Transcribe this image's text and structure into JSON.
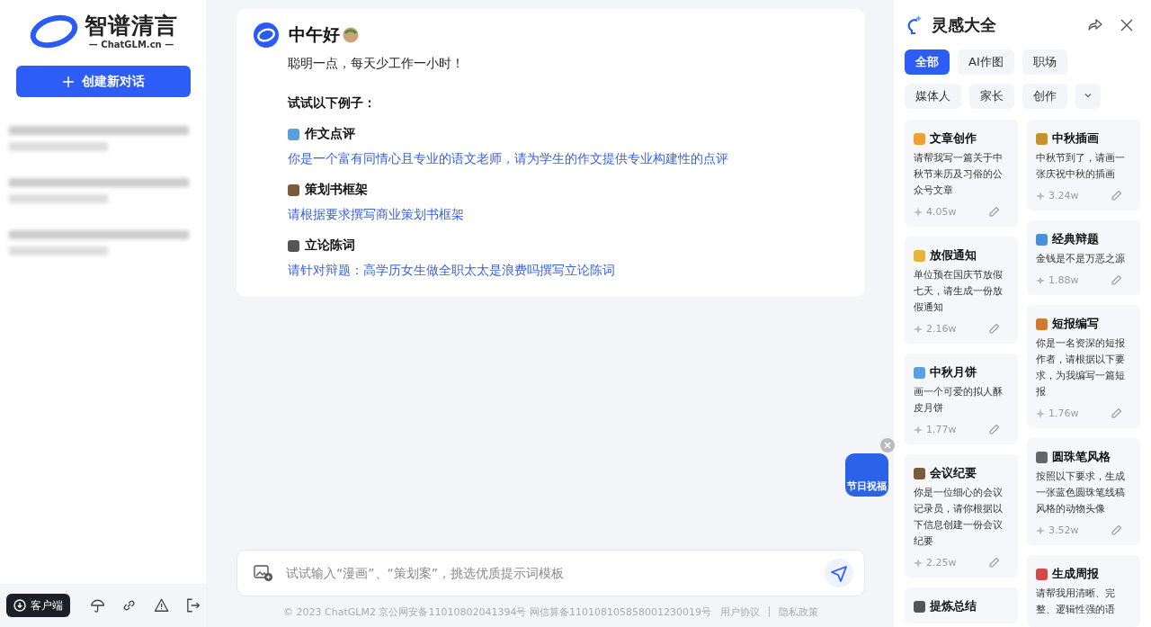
{
  "sidebar": {
    "logo": {
      "name": "智谱清言",
      "domain": "— ChatGLM.cn —"
    },
    "new_chat_button": "创建新对话",
    "bottom": {
      "client_button": "客户端"
    }
  },
  "chat": {
    "greeting": "中午好",
    "subtitle": "聪明一点，每天少工作一小时！",
    "examples_heading": "试试以下例子：",
    "examples": [
      {
        "title": "作文点评",
        "prompt": "你是一个富有同情心且专业的语文老师，请为学生的作文提供专业构建性的点评"
      },
      {
        "title": "策划书框架",
        "prompt": "请根据要求撰写商业策划书框架"
      },
      {
        "title": "立论陈词",
        "prompt": "请针对辩题：高学历女生做全职太太是浪费吗撰写立论陈词"
      }
    ],
    "input": {
      "placeholder": "试试输入“漫画”、“策划案”，挑选优质提示词模板"
    },
    "festival_badge": "节日祝福"
  },
  "footer": {
    "notice": "© 2023 ChatGLM2 京公网安备11010802041394号 网信算备110108105858001230019号",
    "links": [
      "用户协议",
      "隐私政策"
    ]
  },
  "inspiration": {
    "title": "灵感大全",
    "tabs": [
      {
        "label": "全部",
        "selected": true
      },
      {
        "label": "AI作图",
        "selected": false
      },
      {
        "label": "职场",
        "selected": false
      },
      {
        "label": "媒体人",
        "selected": false
      },
      {
        "label": "家长",
        "selected": false
      },
      {
        "label": "创作",
        "selected": false
      }
    ],
    "columns": [
      [
        {
          "title": "文章创作",
          "desc": "请帮我写一篇关于中秋节来历及习俗的公众号文章",
          "count": "4.05w"
        },
        {
          "title": "放假通知",
          "desc": "单位预在国庆节放假七天，请生成一份放假通知",
          "count": "2.16w"
        },
        {
          "title": "中秋月饼",
          "desc": "画一个可爱的拟人酥皮月饼",
          "count": "1.77w"
        },
        {
          "title": "会议纪要",
          "desc": "你是一位细心的会议记录员，请你根据以下信息创建一份会议纪要",
          "count": "2.25w"
        },
        {
          "title": "提炼总结"
        }
      ],
      [
        {
          "title": "中秋插画",
          "desc": "中秋节到了，请画一张庆祝中秋的插画",
          "count": "3.24w"
        },
        {
          "title": "经典辩题",
          "desc": "金钱是不是万恶之源",
          "count": "1.88w"
        },
        {
          "title": "短报编写",
          "desc": "你是一名资深的短报作者，请根据以下要求，为我编写一篇短报",
          "count": "1.76w"
        },
        {
          "title": "圆珠笔风格",
          "desc": "按照以下要求，生成一张蓝色圆珠笔线稿风格的动物头像",
          "count": "3.52w"
        },
        {
          "title": "生成周报",
          "desc": "请帮我用清晰、完整、逻辑性强的语"
        }
      ]
    ]
  }
}
